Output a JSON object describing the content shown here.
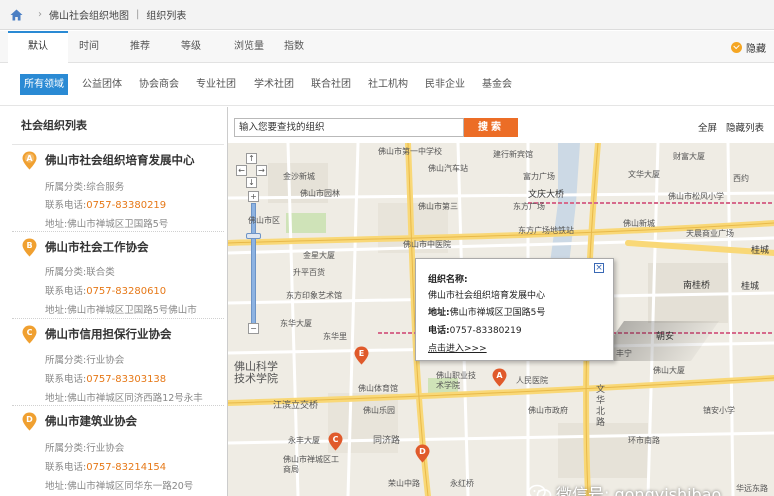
{
  "breadcrumb": {
    "map": "佛山社会组织地图",
    "list": "组织列表"
  },
  "sort_tabs": [
    "默认",
    "时间",
    "推荐",
    "等级",
    "浏览量",
    "指数"
  ],
  "hide_label": "隐藏",
  "categories": [
    "所有领域",
    "公益团体",
    "协会商会",
    "专业社团",
    "学术社团",
    "联合社团",
    "社工机构",
    "民非企业",
    "基金会"
  ],
  "list": {
    "title": "社会组织列表",
    "items": [
      {
        "letter": "A",
        "name": "佛山市社会组织培育发展中心",
        "category": "所属分类:综合服务",
        "phone_label": "联系电话:",
        "phone": "0757-83380219",
        "address": "地址:佛山市禅城区卫国路5号"
      },
      {
        "letter": "B",
        "name": "佛山市社会工作协会",
        "category": "所属分类:联合类",
        "phone_label": "联系电话:",
        "phone": "0757-83280610",
        "address": "地址:佛山市禅城区卫国路5号佛山市"
      },
      {
        "letter": "C",
        "name": "佛山市信用担保行业协会",
        "category": "所属分类:行业协会",
        "phone_label": "联系电话:",
        "phone": "0757-83303138",
        "address": "地址:佛山市禅城区同济西路12号永丰"
      },
      {
        "letter": "D",
        "name": "佛山市建筑业协会",
        "category": "所属分类:行业协会",
        "phone_label": "联系电话:",
        "phone": "0757-83214154",
        "address": "地址:佛山市禅城区同华东一路20号"
      }
    ]
  },
  "map": {
    "search_placeholder": "输入您要查找的组织",
    "search_button": "搜索",
    "full_screen": "全屏",
    "hide_list": "隐藏列表",
    "popup": {
      "name_label": "组织名称:",
      "name": "佛山市社会组织培育发展中心",
      "address_label": "地址:",
      "address": "佛山市禅城区卫国路5号",
      "phone_label": "电话:",
      "phone": "0757-83380219",
      "link": "点击进入>>>"
    },
    "labels": {
      "l1": "佛山市第一中学校",
      "l2": "建行新宾馆",
      "l3": "佛山市第三",
      "l4": "财富大厦",
      "l5": "金沙新城",
      "l6": "佛山汽车站",
      "l7": "富力广场",
      "l8": "文华大厦",
      "l9": "佛山市园林",
      "l10": "西约",
      "l11": "文庆大桥",
      "l12": "佛山市松风小学",
      "l13": "佛山市区",
      "l14": "东方广场",
      "l15": "东方广场地铁站",
      "l16": "佛山新城",
      "l17": "佛山市中医院",
      "l18": "天晨商业广场",
      "l19": "桂城",
      "l20": "金星大厦",
      "l21": "升平百货",
      "l22": "东方印象艺术馆",
      "l23": "南桂桥",
      "l24": "桂城",
      "l25": "佛山二中",
      "l26": "朝安",
      "l27": "东华大厦",
      "l28": "佛山科学技术学院",
      "l29": "江滨立交桥",
      "l30": "佛山体育馆",
      "l31": "佛山职业技术学院",
      "l32": "佛山乐园",
      "l33": "佛山市政府",
      "l34": "文华北路",
      "l35": "同济路",
      "l36": "佛山市禅城区卫国路",
      "l37": "祖庙",
      "l38": "环市南路",
      "l39": "环市北路",
      "l40": "宏宇大厦",
      "l41": "永丰大厦",
      "l42": "荣山中路",
      "l43": "永红桥",
      "l44": "东华里",
      "l45": "镇安小学",
      "l46": "佛山市禅城区工商局",
      "l47": "华远东路",
      "l48": "佛山市禅城区卫生局",
      "l49": "佛山市禅城区工人文化宫",
      "l50": "佛山市二中",
      "l51": "丰宁",
      "l52": "市医院",
      "l53": "桂城地铁站",
      "l54": "佛山市第三人民医院",
      "l55": "佛山大厦",
      "l56": "人民医院",
      "l57": "佛山城",
      "l58": "东方路",
      "l59": "佛山市禅城区"
    }
  },
  "watermark": "微信号: gongyishibao",
  "colors": {
    "accent": "#2a8ad4",
    "orange": "#ec6d26",
    "marker": "#e05a2b",
    "phone": "#e67817"
  }
}
